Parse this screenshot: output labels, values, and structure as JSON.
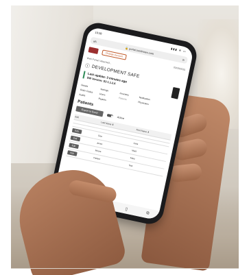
{
  "status": {
    "time": "10:08",
    "signal": "▮▮▮ ≋ ▭"
  },
  "browser": {
    "url": "portal.totalnows.com",
    "url_lock": "🔒",
    "left_label": "aA",
    "refresh": "⟳",
    "bottom_icons": [
      "‹",
      "›",
      "⇪",
      "▯",
      "⧉"
    ]
  },
  "nav": {
    "change_label": "Change Account",
    "date": "03/29/2025"
  },
  "breadcrumb": "Web Portal  /  Attached...",
  "site": {
    "title": "DEVELOPMENT SAFE",
    "last_update": "Last update: 3 minutes ago",
    "sw_version": "SW Version: S3 1.1.2.6"
  },
  "tabs": [
    {
      "label": "Details",
      "dim": false
    },
    {
      "label": "Settings",
      "dim": false
    },
    {
      "label": "Inventory",
      "dim": false
    },
    {
      "label": "Notification",
      "dim": false
    },
    {
      "label": "",
      "dim": false
    },
    {
      "label": "Order Codes",
      "dim": false
    },
    {
      "label": "Users",
      "dim": false
    },
    {
      "label": "Patients",
      "dim": true
    },
    {
      "label": "Physicians",
      "dim": false
    },
    {
      "label": "",
      "dim": false
    },
    {
      "label": "Audits",
      "dim": false
    },
    {
      "label": "Reports",
      "dim": false
    },
    {
      "label": "",
      "dim": false
    },
    {
      "label": "",
      "dim": false
    },
    {
      "label": "",
      "dim": false
    }
  ],
  "patients": {
    "heading": "Patients",
    "export_label": "Export to Excel",
    "active_label": "Active",
    "columns": [
      "Edit",
      "Last Name ⬇",
      "First Name ⬇"
    ],
    "rows": [
      {
        "edit": "",
        "last": "",
        "first": ""
      },
      {
        "edit": "",
        "last": "",
        "first": ""
      },
      {
        "edit": "Edit",
        "last": "Doe",
        "first": "Jane"
      },
      {
        "edit": "Edit",
        "last": "Jones",
        "first": "Mark"
      },
      {
        "edit": "Edit",
        "last": "Moore",
        "first": "Mary"
      },
      {
        "edit": "Edit",
        "last": "Patient",
        "first": "Test"
      }
    ]
  }
}
